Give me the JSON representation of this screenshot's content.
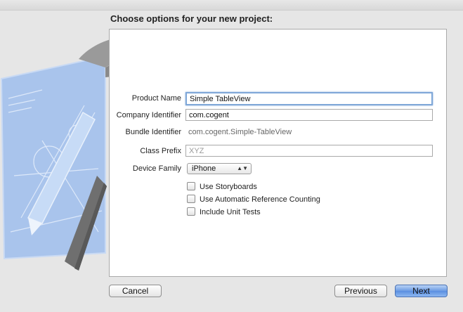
{
  "dialog": {
    "heading": "Choose options for your new project:",
    "background_icon": "xcode-hammer-blueprint-icon"
  },
  "form": {
    "product_name": {
      "label": "Product Name",
      "value": "Simple TableView"
    },
    "company_identifier": {
      "label": "Company Identifier",
      "value": "com.cogent"
    },
    "bundle_identifier": {
      "label": "Bundle Identifier",
      "value": "com.cogent.Simple-TableView"
    },
    "class_prefix": {
      "label": "Class Prefix",
      "value": "",
      "placeholder": "XYZ"
    },
    "device_family": {
      "label": "Device Family",
      "value": "iPhone"
    },
    "options": [
      {
        "label": "Use Storyboards",
        "checked": false
      },
      {
        "label": "Use Automatic Reference Counting",
        "checked": false
      },
      {
        "label": "Include Unit Tests",
        "checked": false
      }
    ]
  },
  "buttons": {
    "cancel": "Cancel",
    "previous": "Previous",
    "next": "Next"
  },
  "colors": {
    "accent": "#5a8ee0",
    "focus_ring": "#7fa7d8",
    "blueprint": "#8fb2e6"
  }
}
